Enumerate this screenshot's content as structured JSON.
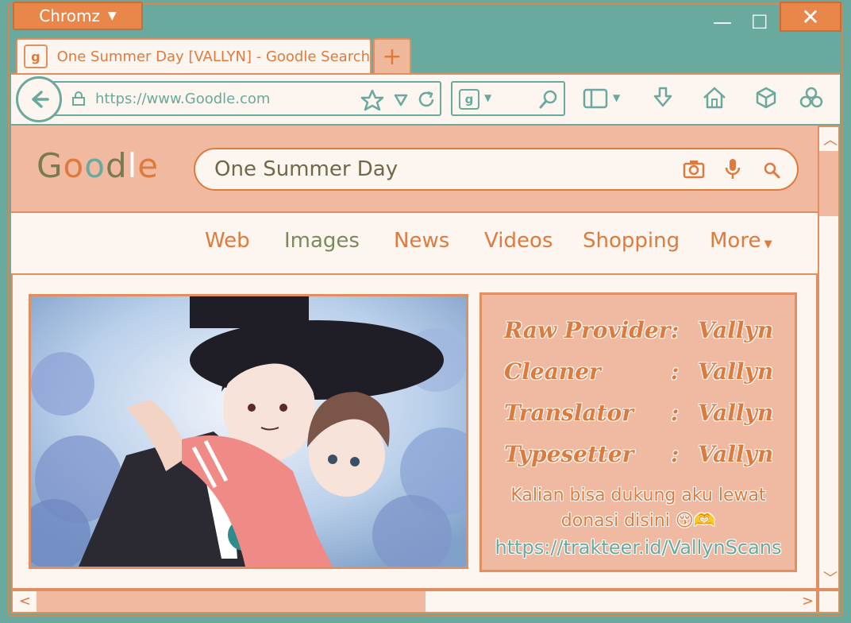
{
  "app": {
    "menu_label": "Chromz",
    "minimize": "—",
    "maximize": "☐",
    "close": "✕"
  },
  "tab": {
    "favicon": "g",
    "title": "One Summer Day [VALLYN] - Goodle Search",
    "new_tab": "+"
  },
  "toolbar": {
    "url": "https://www.Goodle.com",
    "search_engine_icon": "g"
  },
  "page": {
    "logo": {
      "letters": [
        "G",
        "o",
        "o",
        "d",
        "l",
        "e"
      ],
      "colors": [
        "#7a7a52",
        "#dd7b3e",
        "#6aa99d",
        "#7a7a52",
        "#ffffff",
        "#dd7b3e"
      ]
    },
    "search_query": "One Summer Day",
    "nav": {
      "web": "Web",
      "images": "Images",
      "news": "News",
      "videos": "Videos",
      "shopping": "Shopping",
      "more": "More"
    },
    "credits": [
      {
        "role": "Raw Provider",
        "name": "Vallyn"
      },
      {
        "role": "Cleaner",
        "name": "Vallyn"
      },
      {
        "role": "Translator",
        "name": "Vallyn"
      },
      {
        "role": "Typesetter",
        "name": "Vallyn"
      }
    ],
    "colon": ":",
    "support_line1": "Kalian bisa dukung aku lewat",
    "support_line2": "donasi disini 😚🫶",
    "support_link": "https://trakteer.id/VallynScans"
  },
  "colors": {
    "teal": "#6aa99d",
    "orange": "#dd7b3e",
    "peach": "#f1b9a0",
    "cream": "#fdf5ef"
  }
}
